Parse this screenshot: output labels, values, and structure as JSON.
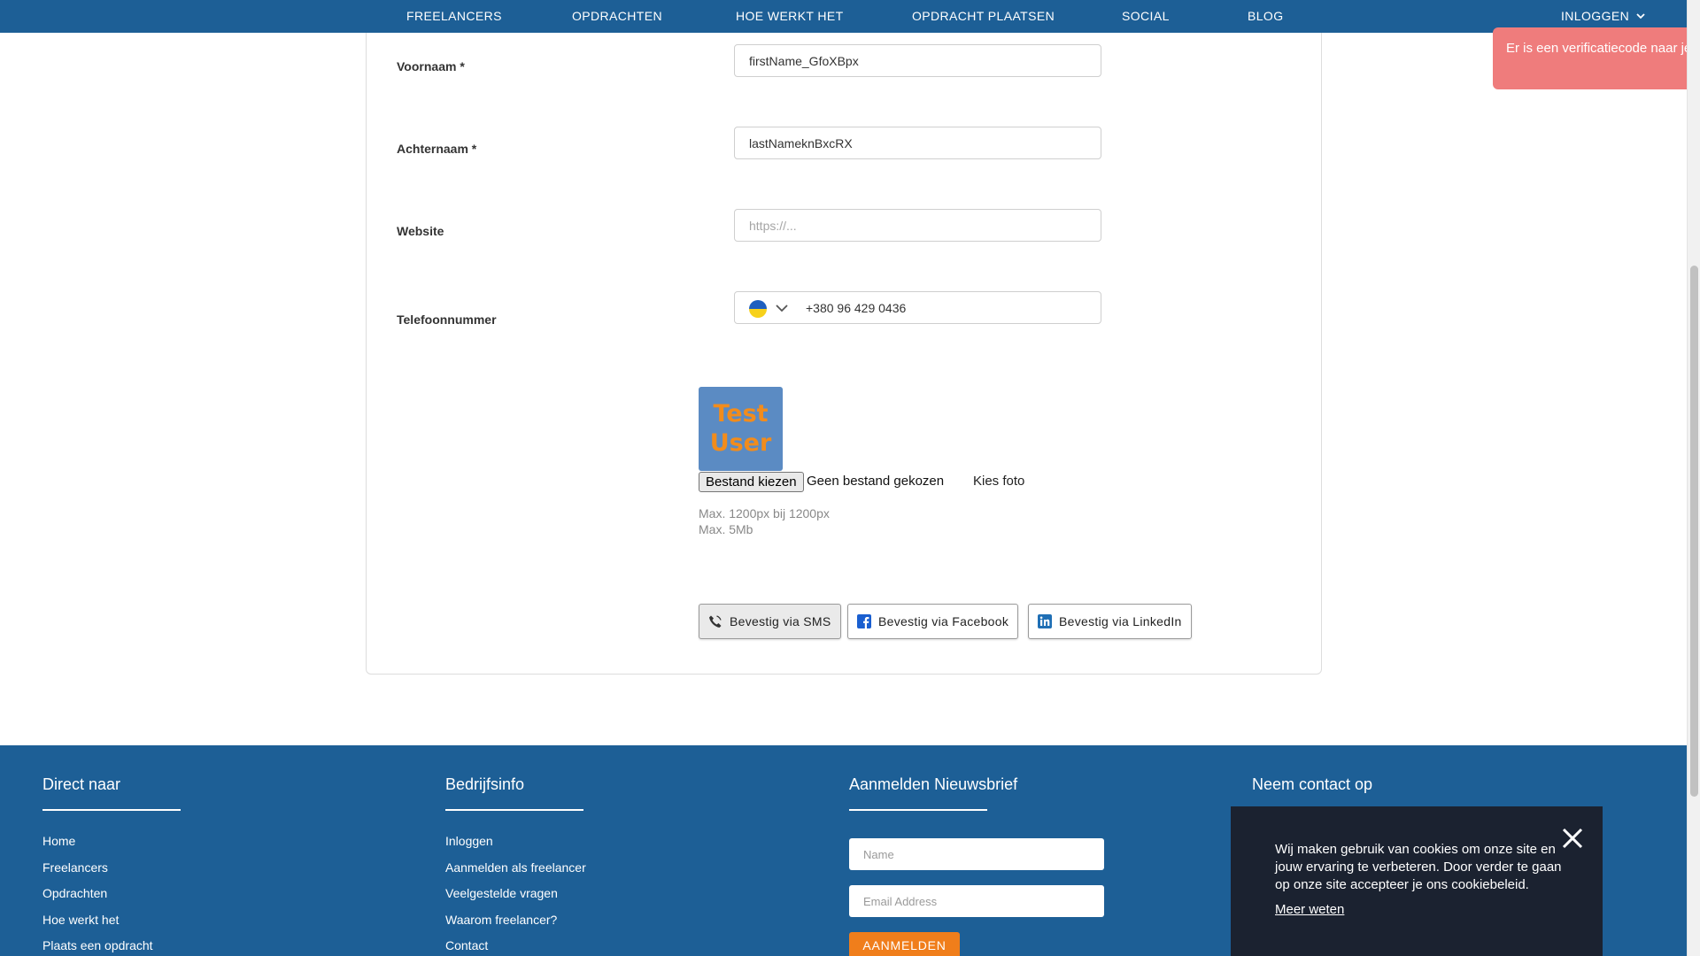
{
  "nav": {
    "items": [
      "FREELANCERS",
      "OPDRACHTEN",
      "HOE WERKT HET",
      "OPDRACHT PLAATSEN",
      "SOCIAL",
      "BLOG"
    ],
    "login": "INLOGGEN"
  },
  "toast": {
    "message": "Er is een verificatiecode naar je verzonden"
  },
  "form": {
    "first_name_label": "Voornaam *",
    "first_name_value": "firstName_GfoXBpx",
    "last_name_label": "Achternaam *",
    "last_name_value": "lastNameknBxcRX",
    "website_label": "Website",
    "website_placeholder": "https://...",
    "phone_label": "Telefoonnummer",
    "phone_value": "+380 96 429 0436",
    "avatar_text": "Test User",
    "file_button": "Bestand kiezen",
    "file_status": "Geen bestand gekozen",
    "choose_photo": "Kies foto",
    "hint_size": "Max. 1200px bij 1200px",
    "hint_weight": "Max. 5Mb",
    "verify_sms": "Bevestig via SMS",
    "verify_facebook": "Bevestig via Facebook",
    "verify_linkedin": "Bevestig via LinkedIn"
  },
  "footer": {
    "col1": {
      "title": "Direct naar",
      "links": [
        "Home",
        "Freelancers",
        "Opdrachten",
        "Hoe werkt het",
        "Plaats een opdracht"
      ]
    },
    "col2": {
      "title": "Bedrijfsinfo",
      "links": [
        "Inloggen",
        "Aanmelden als freelancer",
        "Veelgestelde vragen",
        "Waarom freelancer?",
        "Contact"
      ]
    },
    "col3": {
      "title": "Aanmelden Nieuwsbrief",
      "name_placeholder": "Name",
      "email_placeholder": "Email Address",
      "submit": "AANMELDEN"
    },
    "col4": {
      "title": "Neem contact op"
    }
  },
  "cookie": {
    "text": "Wij maken gebruik van cookies om onze site en jouw ervaring te verbeteren. Door verder te gaan op onze site accepteer je ons cookiebeleid.",
    "more": "Meer weten"
  },
  "colors": {
    "nav_bg": "#1d5f96",
    "footer_bg": "#1d5f96",
    "toast_bg": "#ef7c7c",
    "cta": "#f07e1b",
    "cookie_bg": "#1b2230"
  },
  "icons": [
    "chevron-down-icon",
    "phone-icon",
    "facebook-icon",
    "linkedin-icon",
    "close-icon",
    "ukraine-flag-icon"
  ]
}
